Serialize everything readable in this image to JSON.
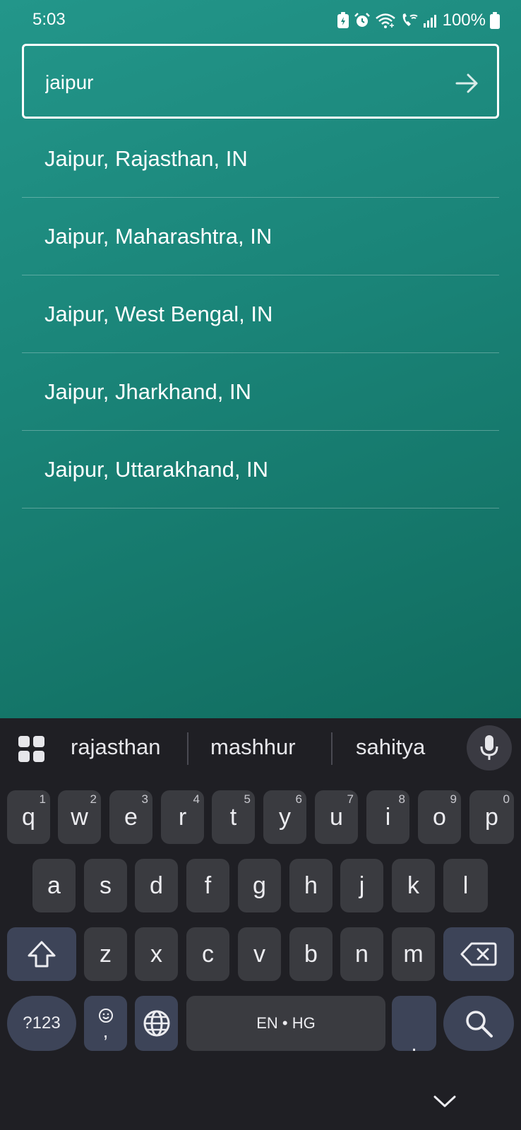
{
  "status_bar": {
    "time": "5:03",
    "battery_percent": "100%",
    "icons": [
      "battery-saver-icon",
      "alarm-icon",
      "wifi-icon",
      "wifi-calling-icon",
      "signal-icon",
      "battery-icon"
    ]
  },
  "search": {
    "value": "jaipur",
    "submit_icon": "arrow-right-icon"
  },
  "suggestions": [
    "Jaipur, Rajasthan, IN",
    "Jaipur, Maharashtra, IN",
    "Jaipur, West Bengal, IN",
    "Jaipur, Jharkhand, IN",
    "Jaipur, Uttarakhand, IN"
  ],
  "keyboard": {
    "word_suggestions": [
      "rajasthan",
      "mashhur",
      "sahitya"
    ],
    "row1": [
      {
        "key": "q",
        "hint": "1"
      },
      {
        "key": "w",
        "hint": "2"
      },
      {
        "key": "e",
        "hint": "3"
      },
      {
        "key": "r",
        "hint": "4"
      },
      {
        "key": "t",
        "hint": "5"
      },
      {
        "key": "y",
        "hint": "6"
      },
      {
        "key": "u",
        "hint": "7"
      },
      {
        "key": "i",
        "hint": "8"
      },
      {
        "key": "o",
        "hint": "9"
      },
      {
        "key": "p",
        "hint": "0"
      }
    ],
    "row2": [
      "a",
      "s",
      "d",
      "f",
      "g",
      "h",
      "j",
      "k",
      "l"
    ],
    "row3": [
      "z",
      "x",
      "c",
      "v",
      "b",
      "n",
      "m"
    ],
    "symbols_label": "?123",
    "emoji_comma_label": ",",
    "space_label": "EN • HG",
    "period_label": ".",
    "colors": {
      "background": "#1f1f24",
      "key": "#3a3b40",
      "special_key": "#3d4458",
      "app_gradient_top": "#23968a",
      "app_gradient_bottom": "#116c5f"
    }
  }
}
